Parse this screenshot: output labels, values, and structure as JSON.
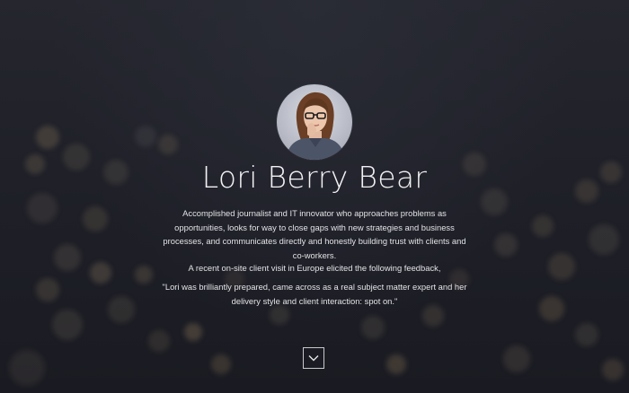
{
  "profile": {
    "avatar_alt": "Lori Berry Bear portrait",
    "name": "Lori Berry Bear",
    "bio": "Accomplished journalist and IT innovator who approaches problems as opportunities, looks for way to close gaps with new strategies and business processes, and communicates directly and honestly building trust with clients and co-workers.",
    "feedback_intro": "A recent on-site client visit in Europe elicited the following feedback,",
    "quote": "\"Lori was brilliantly prepared, came across as a real subject matter expert and her delivery style and client interaction: spot on.\""
  },
  "scroll": {
    "icon": "chevron-down-icon"
  },
  "colors": {
    "background": "#1c1d24",
    "text": "#e3e3e7",
    "name_text": "#f2f2f4",
    "bokeh_warm": "#c9a46a"
  }
}
